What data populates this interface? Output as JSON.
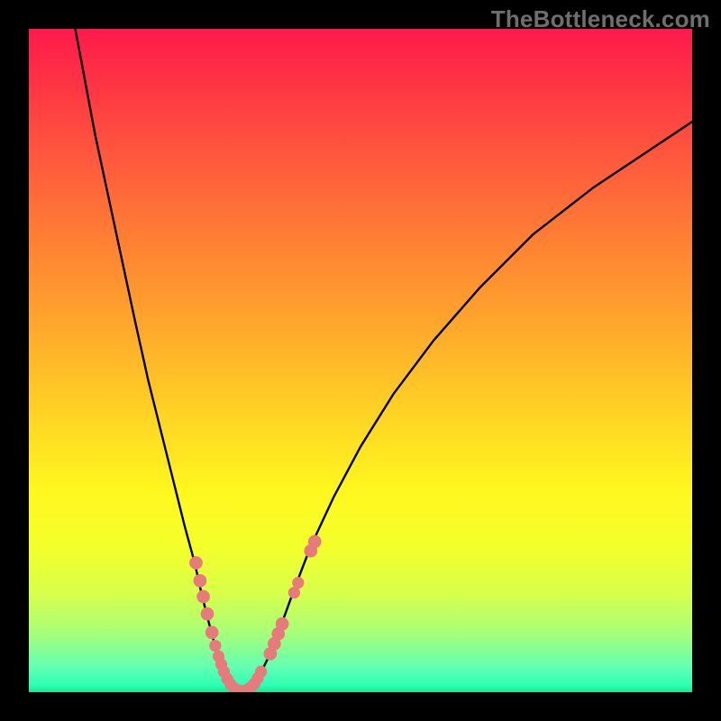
{
  "watermark": "TheBottleneck.com",
  "colors": {
    "curve": "#000000",
    "marker": "#e77a7a",
    "frame_bg": "#000000"
  },
  "chart_data": {
    "type": "line",
    "title": "",
    "xlabel": "",
    "ylabel": "",
    "xlim": [
      0,
      100
    ],
    "ylim": [
      0,
      100
    ],
    "grid": false,
    "legend": false,
    "series": [
      {
        "name": "left-branch",
        "x": [
          7,
          10,
          13,
          16,
          18,
          20,
          22,
          23.5,
          25,
          26,
          27,
          27.8,
          28.5,
          29,
          29.5,
          30,
          30.5,
          31
        ],
        "y": [
          100,
          84,
          70,
          56,
          47,
          39,
          31,
          25,
          19.5,
          15,
          11,
          8,
          5.5,
          3.8,
          2.5,
          1.5,
          0.7,
          0.2
        ]
      },
      {
        "name": "right-branch",
        "x": [
          33,
          34,
          35,
          36.5,
          38,
          40,
          42.5,
          46,
          50,
          55,
          61,
          68,
          76,
          85,
          94,
          100
        ],
        "y": [
          0.2,
          1.2,
          3,
          6,
          10,
          15.5,
          22,
          29.5,
          37,
          45,
          53,
          61,
          69,
          76,
          82,
          86
        ]
      }
    ],
    "markers": [
      {
        "x": 25.2,
        "y": 19.5,
        "r": 1.0
      },
      {
        "x": 25.8,
        "y": 16.8,
        "r": 1.0
      },
      {
        "x": 26.3,
        "y": 14.4,
        "r": 1.0
      },
      {
        "x": 26.9,
        "y": 11.8,
        "r": 1.0
      },
      {
        "x": 27.6,
        "y": 9.0,
        "r": 1.0
      },
      {
        "x": 28.1,
        "y": 7.0,
        "r": 0.9
      },
      {
        "x": 28.6,
        "y": 5.4,
        "r": 0.9
      },
      {
        "x": 29.0,
        "y": 4.2,
        "r": 0.9
      },
      {
        "x": 29.4,
        "y": 3.1,
        "r": 0.9
      },
      {
        "x": 29.9,
        "y": 2.0,
        "r": 0.9
      },
      {
        "x": 30.4,
        "y": 1.2,
        "r": 0.9
      },
      {
        "x": 31.0,
        "y": 0.55,
        "r": 0.9
      },
      {
        "x": 31.6,
        "y": 0.25,
        "r": 0.9
      },
      {
        "x": 32.2,
        "y": 0.2,
        "r": 0.9
      },
      {
        "x": 32.8,
        "y": 0.3,
        "r": 0.9
      },
      {
        "x": 33.4,
        "y": 0.7,
        "r": 0.9
      },
      {
        "x": 34.0,
        "y": 1.3,
        "r": 0.9
      },
      {
        "x": 34.5,
        "y": 2.1,
        "r": 0.9
      },
      {
        "x": 35.0,
        "y": 3.1,
        "r": 0.9
      },
      {
        "x": 36.4,
        "y": 5.8,
        "r": 1.0
      },
      {
        "x": 37.0,
        "y": 7.3,
        "r": 1.0
      },
      {
        "x": 37.6,
        "y": 8.8,
        "r": 1.0
      },
      {
        "x": 38.2,
        "y": 10.3,
        "r": 1.0
      },
      {
        "x": 40.0,
        "y": 15.0,
        "r": 0.9
      },
      {
        "x": 40.6,
        "y": 16.5,
        "r": 0.9
      },
      {
        "x": 42.5,
        "y": 21.3,
        "r": 1.0
      },
      {
        "x": 43.1,
        "y": 22.7,
        "r": 1.0
      }
    ]
  }
}
